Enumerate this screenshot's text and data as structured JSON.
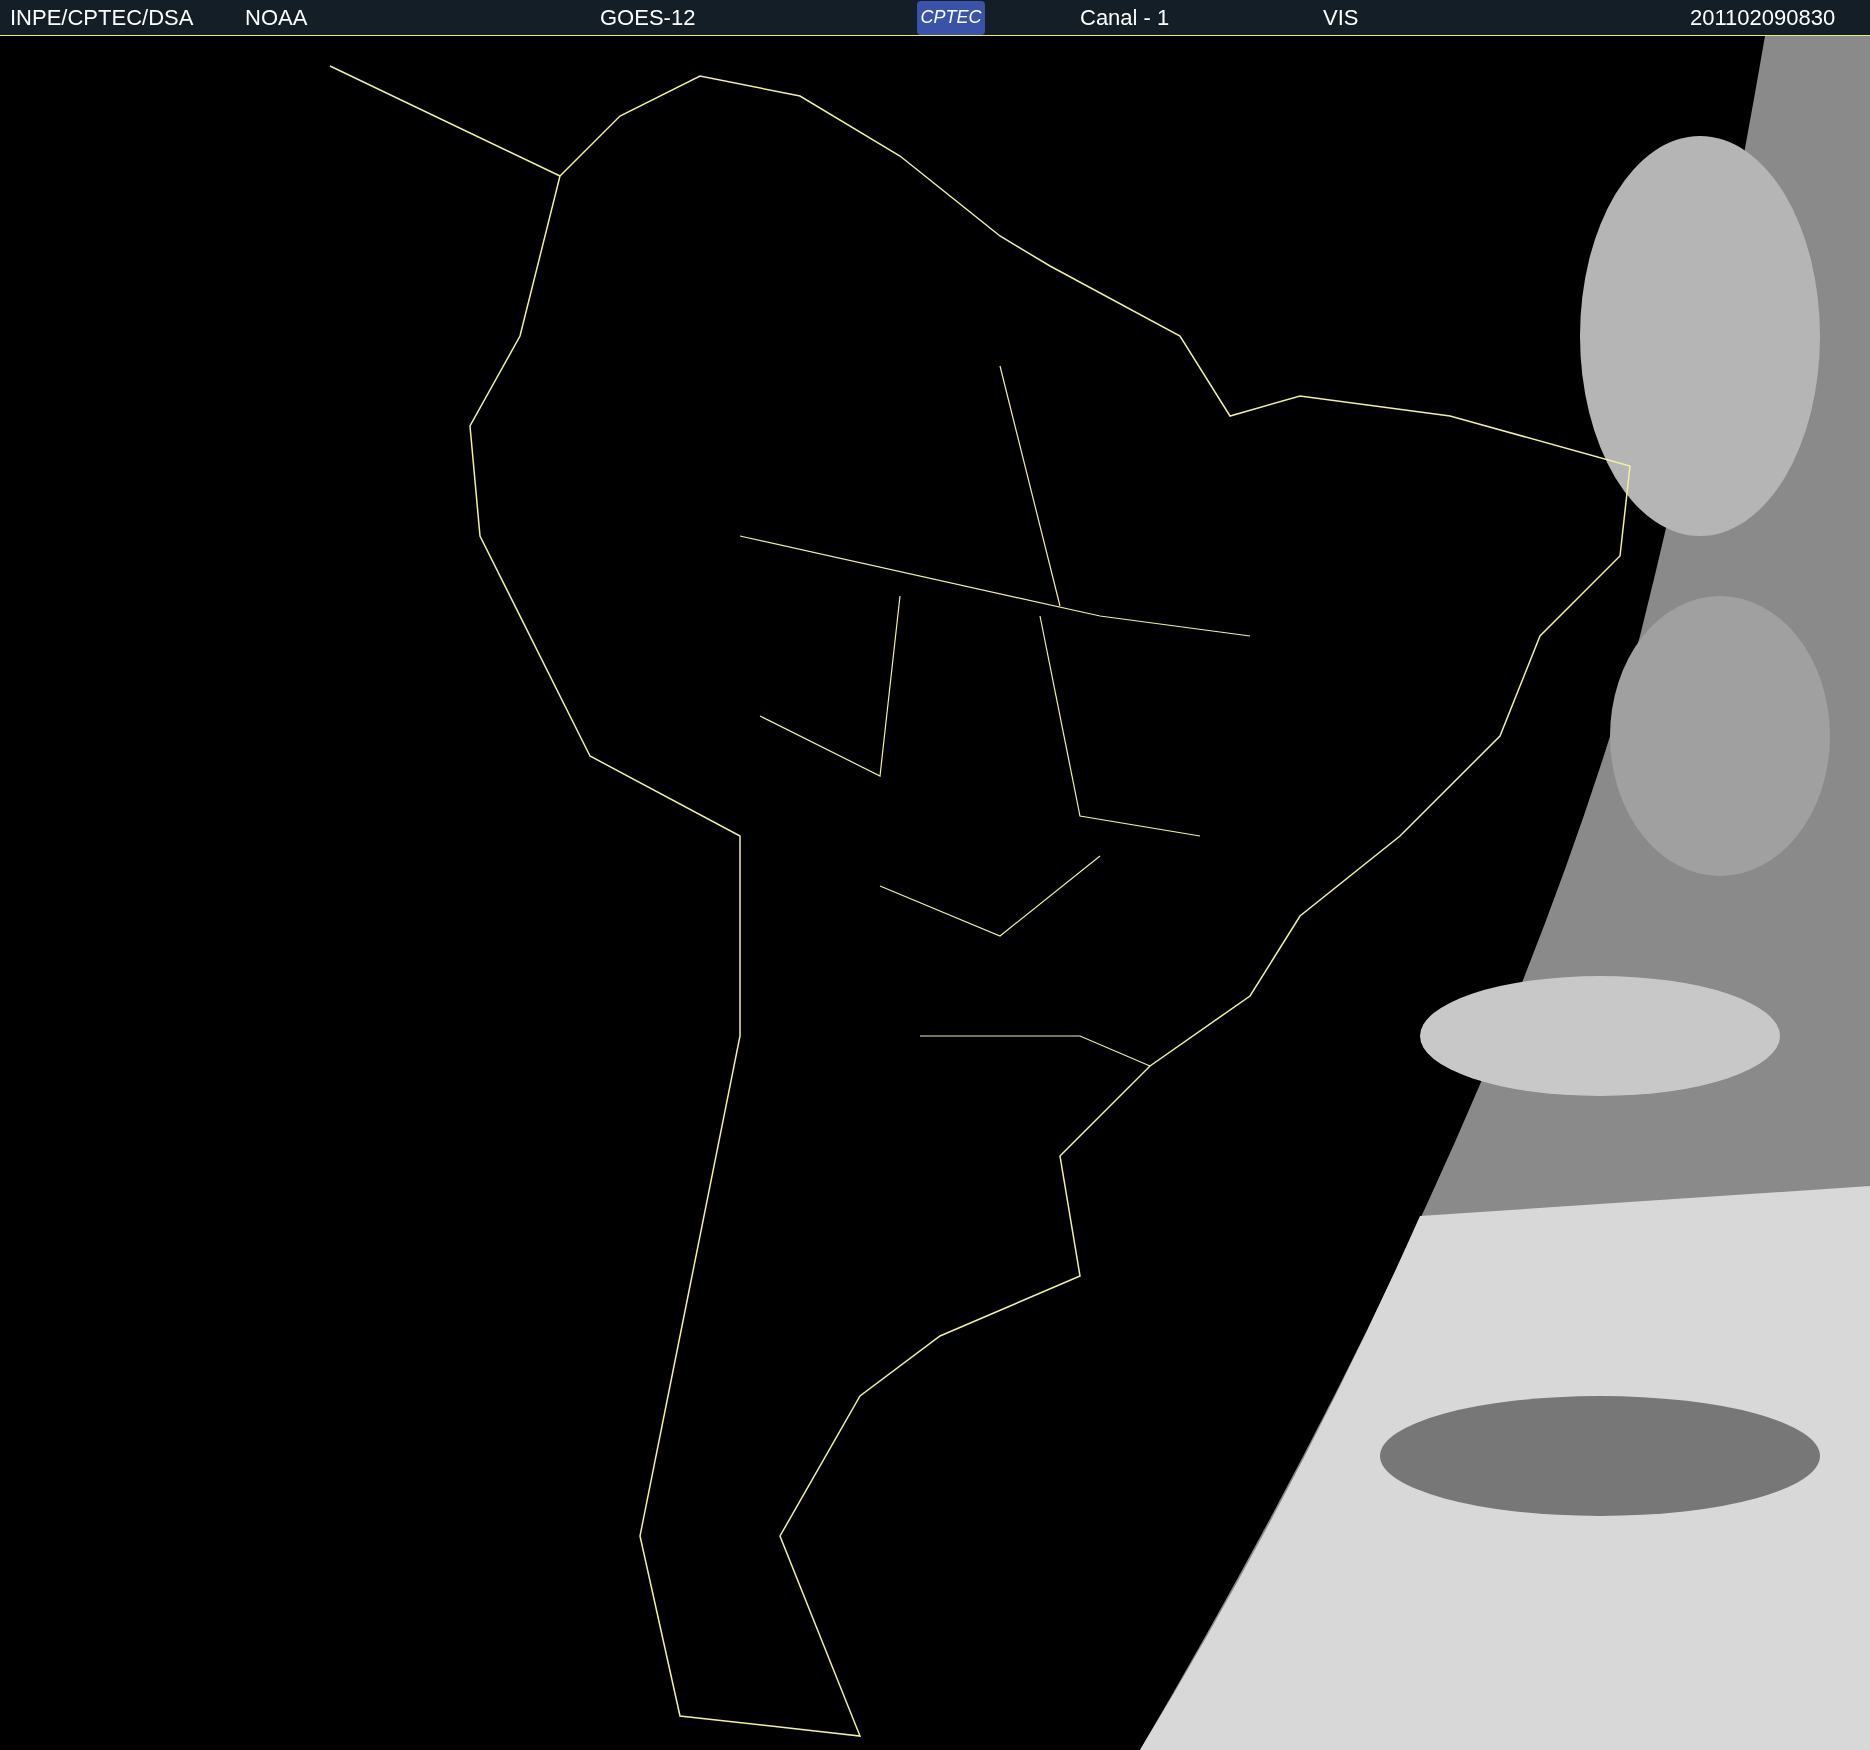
{
  "header": {
    "source": "INPE/CPTEC/DSA",
    "agency": "NOAA",
    "satellite": "GOES-12",
    "logo_text": "CPTEC",
    "channel": "Canal - 1",
    "band": "VIS",
    "timestamp": "201102090830"
  }
}
